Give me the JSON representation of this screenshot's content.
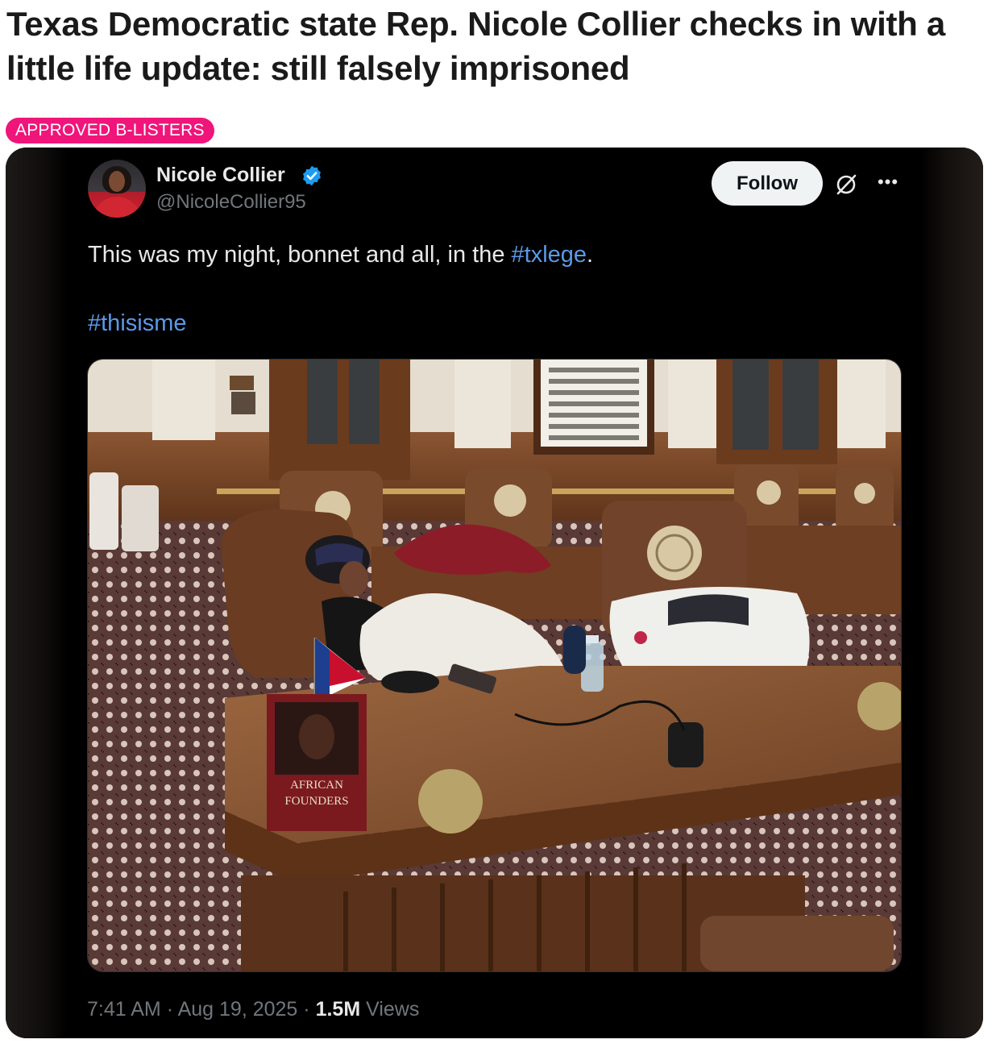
{
  "article": {
    "headline": "Texas Democratic state Rep. Nicole Collier checks in with a little life update: still falsely imprisoned",
    "tag": "APPROVED B-LISTERS"
  },
  "tweet": {
    "author_name": "Nicole Collier",
    "author_handle": "@NicoleCollier95",
    "follow_label": "Follow",
    "text_before": "This was my night, bonnet and all, in the ",
    "hashtag_1": "#txlege",
    "text_after": ".",
    "hashtag_2": "#thisisme",
    "time": "7:41 AM",
    "date": "Aug 19, 2025",
    "views_count": "1.5M",
    "views_label": "Views",
    "separator": "·"
  },
  "icons": {
    "verified": "verified-badge-icon",
    "grok": "grok-icon",
    "more": "more-options-icon"
  },
  "photo": {
    "book_title_line1": "AFRICAN",
    "book_title_line2": "FOUNDERS"
  },
  "colors": {
    "tag_bg": "#f0157a",
    "card_bg": "#000000",
    "link": "#5b9ae8",
    "verified": "#1d9bf0",
    "muted": "#71767b"
  }
}
